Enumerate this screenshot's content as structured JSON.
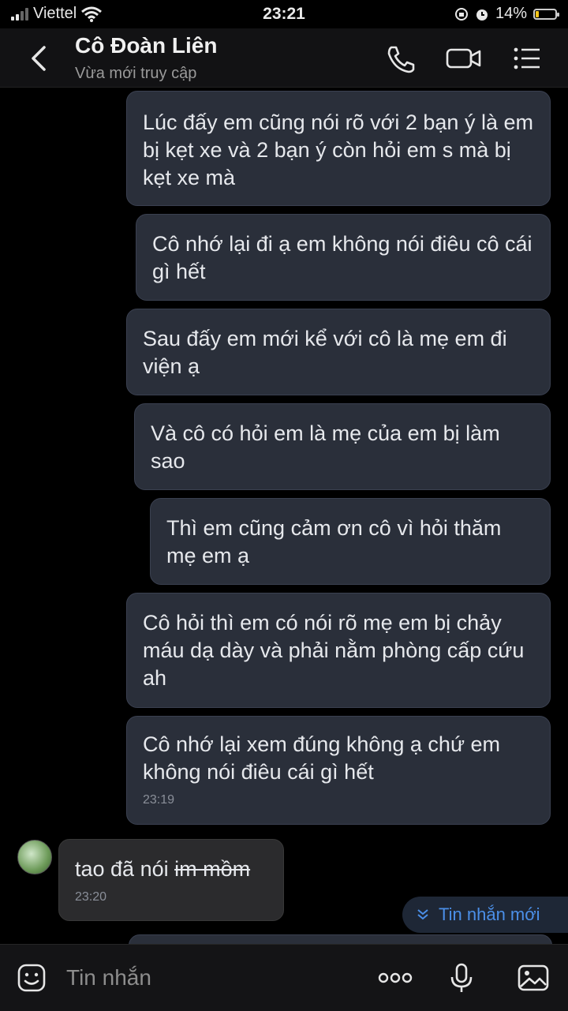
{
  "status_bar": {
    "carrier": "Viettel",
    "time": "23:21",
    "battery": "14%",
    "battery_level": 0.14
  },
  "header": {
    "title": "Cô Đoàn Liên",
    "subtitle": "Vừa mới truy cập",
    "icons": [
      "back-icon",
      "phone-icon",
      "video-call-icon",
      "menu-icon"
    ]
  },
  "messages": [
    {
      "text": "Lúc đấy em cũng nói rõ với 2 bạn ý là em bị kẹt xe và 2 bạn ý còn hỏi em s mà bị kẹt xe mà"
    },
    {
      "text": "Cô nhớ lại đi ạ em không nói điêu cô cái gì hết"
    },
    {
      "text": "Sau đấy em mới kể với cô là mẹ em đi viện ạ"
    },
    {
      "text": "Và cô có hỏi em là mẹ của em bị làm sao"
    },
    {
      "text": "Thì em cũng cảm ơn cô vì hỏi thăm mẹ em ạ"
    },
    {
      "text": "Cô hỏi thì em có nói rõ mẹ em bị chảy máu dạ dày và phải nằm phòng cấp cứu ah"
    },
    {
      "text": "Cô nhớ lại xem đúng không ạ chứ em không nói điêu cái gì hết",
      "time": "23:19"
    }
  ],
  "incoming": {
    "text_plain": "tao đã nói ",
    "text_struck": "im mồm",
    "time": "23:20"
  },
  "new_message_label": "Tin nhắn mới",
  "composer": {
    "placeholder": "Tin nhắn",
    "icons": [
      "sticker-icon",
      "more-icon",
      "microphone-icon",
      "image-icon"
    ]
  },
  "colors": {
    "outgoing_bubble": "#2a2f3a",
    "incoming_bubble": "#2b2b2d",
    "accent": "#4b8fe8",
    "battery_fill": "#f5c518"
  }
}
